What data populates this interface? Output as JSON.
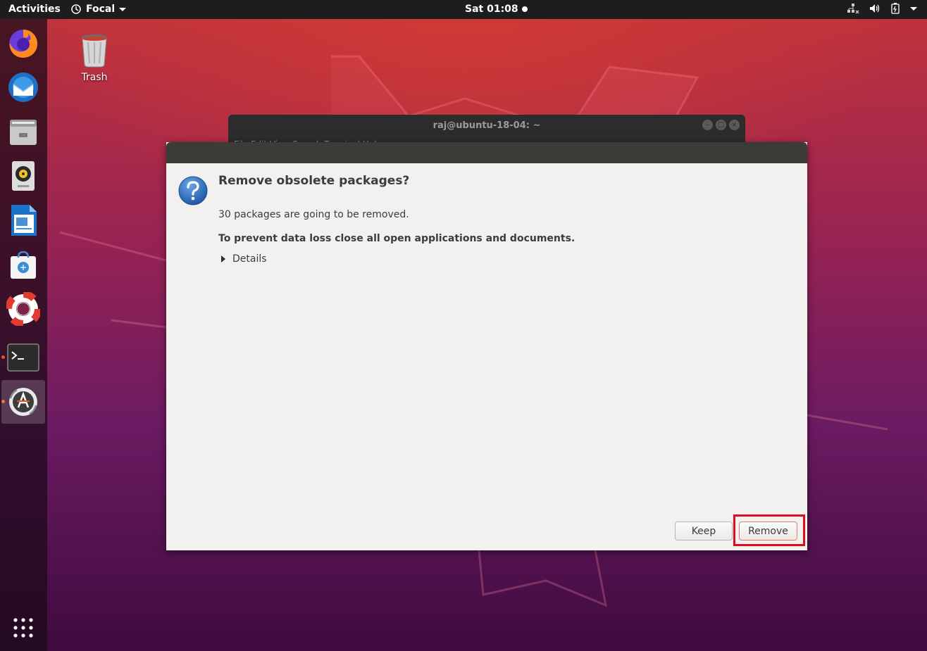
{
  "topbar": {
    "activities": "Activities",
    "app_name": "Focal",
    "clock": "Sat 01:08"
  },
  "desktop": {
    "trash_label": "Trash"
  },
  "dock": {
    "items": [
      {
        "icon": "firefox-icon"
      },
      {
        "icon": "thunderbird-icon"
      },
      {
        "icon": "files-icon"
      },
      {
        "icon": "rhythmbox-icon"
      },
      {
        "icon": "libreoffice-writer-icon"
      },
      {
        "icon": "software-store-icon"
      },
      {
        "icon": "help-icon"
      },
      {
        "icon": "terminal-icon"
      },
      {
        "icon": "software-updater-icon"
      },
      {
        "icon": "show-apps-icon"
      }
    ]
  },
  "terminal": {
    "title": "raj@ubuntu-18-04: ~",
    "menu": "File  Edit  View  Search  Terminal  Help"
  },
  "dialog": {
    "heading": "Remove obsolete packages?",
    "message": "30 packages are going to be removed.",
    "warning": "To prevent data loss close all open applications and documents.",
    "details_label": "Details",
    "keep_label": "Keep",
    "remove_label": "Remove"
  },
  "colors": {
    "accent": "#e95420",
    "highlight": "#e00d20"
  }
}
